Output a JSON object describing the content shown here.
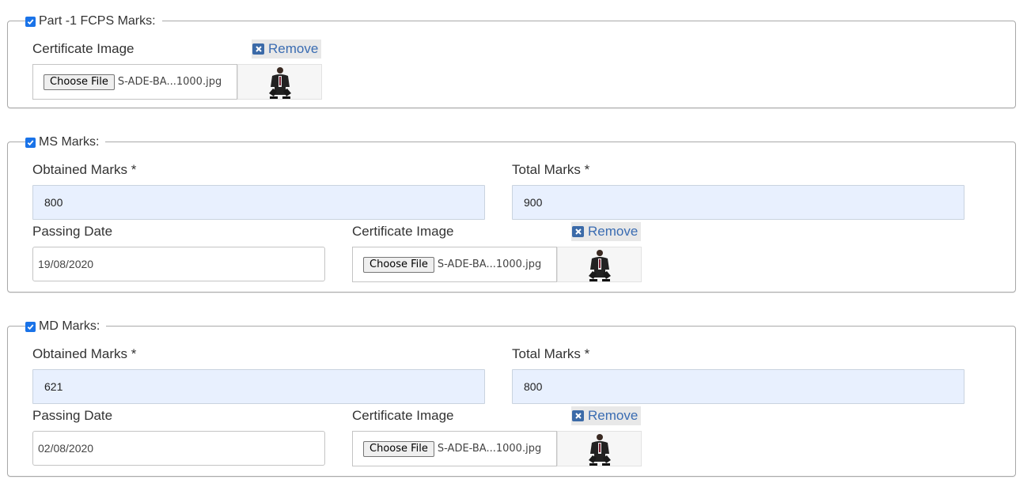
{
  "sections": [
    {
      "legend": "Part -1 FCPS Marks:",
      "checked": true,
      "certificate_label": "Certificate Image",
      "remove_label": "Remove",
      "choose_file_label": "Choose File",
      "file_name": "S-ADE-BA...1000.jpg"
    },
    {
      "legend": "MS Marks:",
      "checked": true,
      "obtained_label": "Obtained Marks *",
      "obtained_value": "800",
      "total_label": "Total Marks *",
      "total_value": "900",
      "passing_label": "Passing Date",
      "passing_value": "19/08/2020",
      "certificate_label": "Certificate Image",
      "remove_label": "Remove",
      "choose_file_label": "Choose File",
      "file_name": "S-ADE-BA...1000.jpg"
    },
    {
      "legend": "MD Marks:",
      "checked": true,
      "obtained_label": "Obtained Marks *",
      "obtained_value": "621",
      "total_label": "Total Marks *",
      "total_value": "800",
      "passing_label": "Passing Date",
      "passing_value": "02/08/2020",
      "certificate_label": "Certificate Image",
      "remove_label": "Remove",
      "choose_file_label": "Choose File",
      "file_name": "S-ADE-BA...1000.jpg"
    }
  ],
  "colors": {
    "checkbox": "#1a73e8",
    "filled_input_bg": "#e8f0fe",
    "remove_text": "#3a6cb2",
    "remove_icon": "#3b6aa8"
  },
  "icons": {
    "checkbox": "checkmark-icon",
    "remove": "close-square-icon",
    "thumbnail": "person-photo-icon"
  }
}
